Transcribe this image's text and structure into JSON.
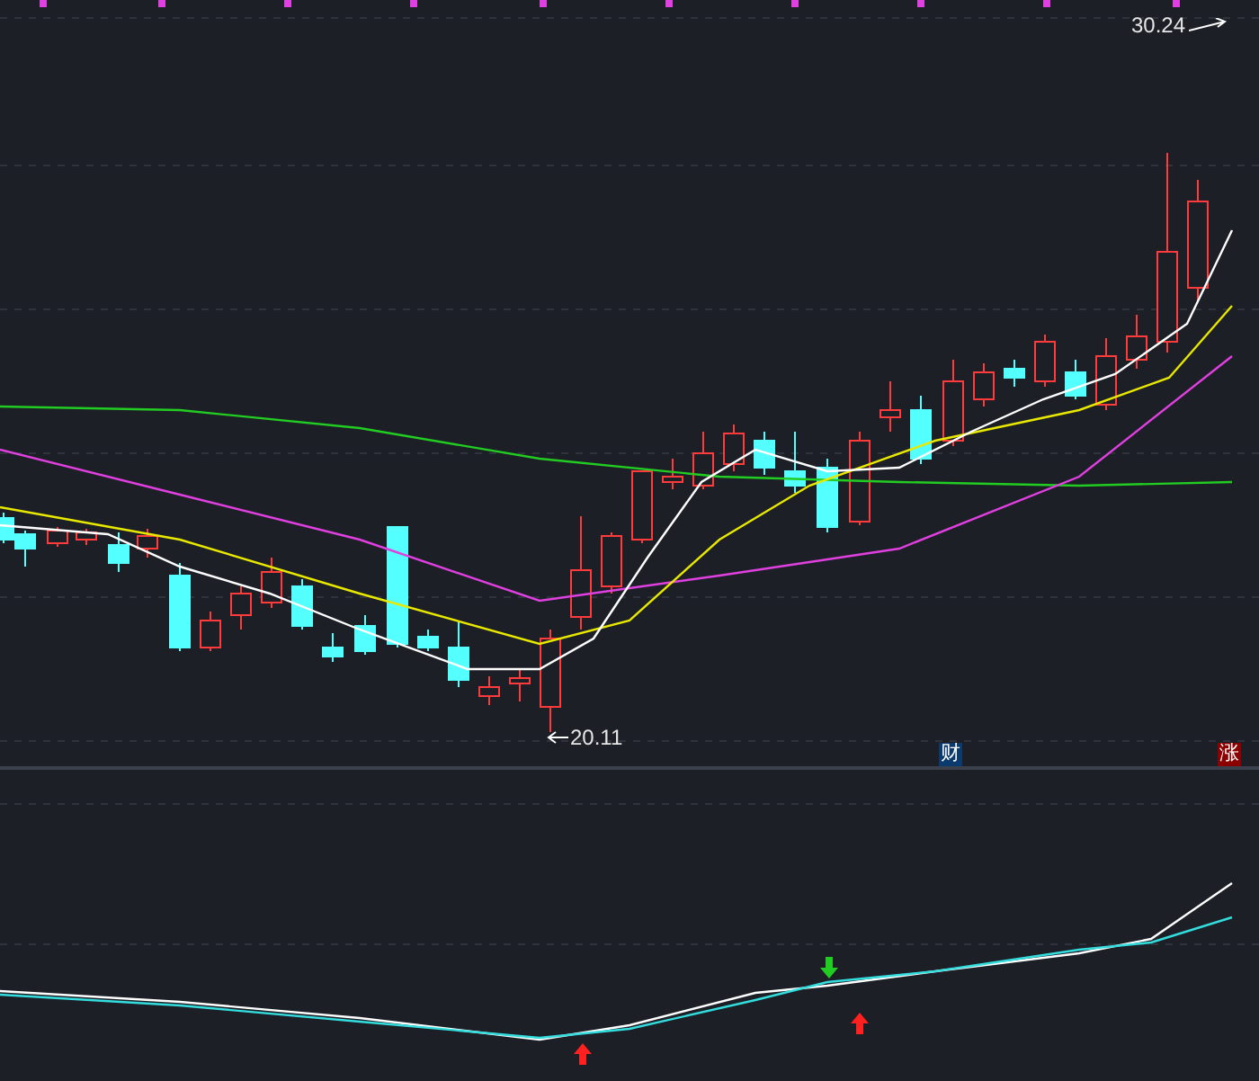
{
  "price_chart": {
    "high_label": "30.24",
    "low_label": "20.11"
  },
  "event_markers": [
    {
      "text": "财",
      "color": "#0b3a6e"
    },
    {
      "text": "涨",
      "color": "#8b0000"
    }
  ]
}
